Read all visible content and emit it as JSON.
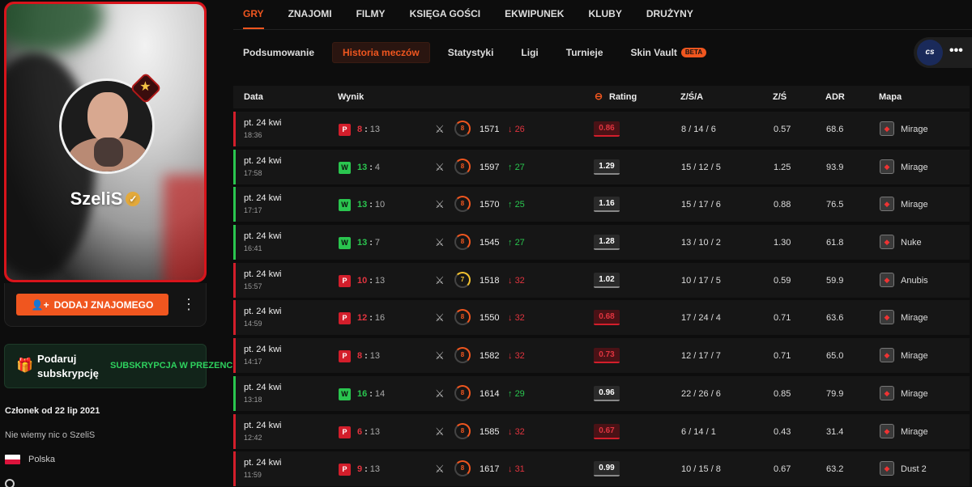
{
  "profile": {
    "username": "SzeliS",
    "add_friend_label": "DODAJ ZNAJOMEGO",
    "gift_label": "Podaruj subskrypcję",
    "gift_link": "SUBSKRYPCJA W PREZENCIE",
    "member_since": "Członek od 22 lip 2021",
    "about": "Nie wiemy nic o SzeliS",
    "country": "Polska"
  },
  "top_nav": [
    "GRY",
    "ZNAJOMI",
    "FILMY",
    "KSIĘGA GOŚCI",
    "EKWIPUNEK",
    "KLUBY",
    "DRUŻYNY"
  ],
  "sub_nav": [
    "Podsumowanie",
    "Historia meczów",
    "Statystyki",
    "Ligi",
    "Turnieje",
    "Skin Vault"
  ],
  "sub_nav_beta": "BETA",
  "game_logo": "cs",
  "columns": {
    "date": "Data",
    "result": "Wynik",
    "rating": "Rating",
    "kda": "Z/Ś/A",
    "kd": "Z/Ś",
    "adr": "ADR",
    "map": "Mapa"
  },
  "matches": [
    {
      "date": "pt. 24 kwi",
      "time": "18:36",
      "result": "P",
      "win": false,
      "score_a": "8",
      "score_b": "13",
      "level": "8",
      "elo": "1571",
      "diff": "26",
      "up": false,
      "rating": "0.86",
      "rating_good": false,
      "kda": "8 / 14 / 6",
      "kd": "0.57",
      "adr": "68.6",
      "map": "Mirage"
    },
    {
      "date": "pt. 24 kwi",
      "time": "17:58",
      "result": "W",
      "win": true,
      "score_a": "13",
      "score_b": "4",
      "level": "8",
      "elo": "1597",
      "diff": "27",
      "up": true,
      "rating": "1.29",
      "rating_good": true,
      "kda": "15 / 12 / 5",
      "kd": "1.25",
      "adr": "93.9",
      "map": "Mirage"
    },
    {
      "date": "pt. 24 kwi",
      "time": "17:17",
      "result": "W",
      "win": true,
      "score_a": "13",
      "score_b": "10",
      "level": "8",
      "elo": "1570",
      "diff": "25",
      "up": true,
      "rating": "1.16",
      "rating_good": true,
      "kda": "15 / 17 / 6",
      "kd": "0.88",
      "adr": "76.5",
      "map": "Mirage"
    },
    {
      "date": "pt. 24 kwi",
      "time": "16:41",
      "result": "W",
      "win": true,
      "score_a": "13",
      "score_b": "7",
      "level": "8",
      "elo": "1545",
      "diff": "27",
      "up": true,
      "rating": "1.28",
      "rating_good": true,
      "kda": "13 / 10 / 2",
      "kd": "1.30",
      "adr": "61.8",
      "map": "Nuke"
    },
    {
      "date": "pt. 24 kwi",
      "time": "15:57",
      "result": "P",
      "win": false,
      "score_a": "10",
      "score_b": "13",
      "level": "7",
      "elo": "1518",
      "diff": "32",
      "up": false,
      "rating": "1.02",
      "rating_good": true,
      "kda": "10 / 17 / 5",
      "kd": "0.59",
      "adr": "59.9",
      "map": "Anubis"
    },
    {
      "date": "pt. 24 kwi",
      "time": "14:59",
      "result": "P",
      "win": false,
      "score_a": "12",
      "score_b": "16",
      "level": "8",
      "elo": "1550",
      "diff": "32",
      "up": false,
      "rating": "0.68",
      "rating_good": false,
      "kda": "17 / 24 / 4",
      "kd": "0.71",
      "adr": "63.6",
      "map": "Mirage"
    },
    {
      "date": "pt. 24 kwi",
      "time": "14:17",
      "result": "P",
      "win": false,
      "score_a": "8",
      "score_b": "13",
      "level": "8",
      "elo": "1582",
      "diff": "32",
      "up": false,
      "rating": "0.73",
      "rating_good": false,
      "kda": "12 / 17 / 7",
      "kd": "0.71",
      "adr": "65.0",
      "map": "Mirage"
    },
    {
      "date": "pt. 24 kwi",
      "time": "13:18",
      "result": "W",
      "win": true,
      "score_a": "16",
      "score_b": "14",
      "level": "8",
      "elo": "1614",
      "diff": "29",
      "up": true,
      "rating": "0.96",
      "rating_good": true,
      "kda": "22 / 26 / 6",
      "kd": "0.85",
      "adr": "79.9",
      "map": "Mirage"
    },
    {
      "date": "pt. 24 kwi",
      "time": "12:42",
      "result": "P",
      "win": false,
      "score_a": "6",
      "score_b": "13",
      "level": "8",
      "elo": "1585",
      "diff": "32",
      "up": false,
      "rating": "0.67",
      "rating_good": false,
      "kda": "6 / 14 / 1",
      "kd": "0.43",
      "adr": "31.4",
      "map": "Mirage"
    },
    {
      "date": "pt. 24 kwi",
      "time": "11:59",
      "result": "P",
      "win": false,
      "score_a": "9",
      "score_b": "13",
      "level": "8",
      "elo": "1617",
      "diff": "31",
      "up": false,
      "rating": "0.99",
      "rating_good": true,
      "kda": "10 / 15 / 8",
      "kd": "0.67",
      "adr": "63.2",
      "map": "Dust 2"
    }
  ],
  "colors": {
    "accent": "#f0561f",
    "win": "#2ac54f",
    "loss": "#d31e2b"
  }
}
